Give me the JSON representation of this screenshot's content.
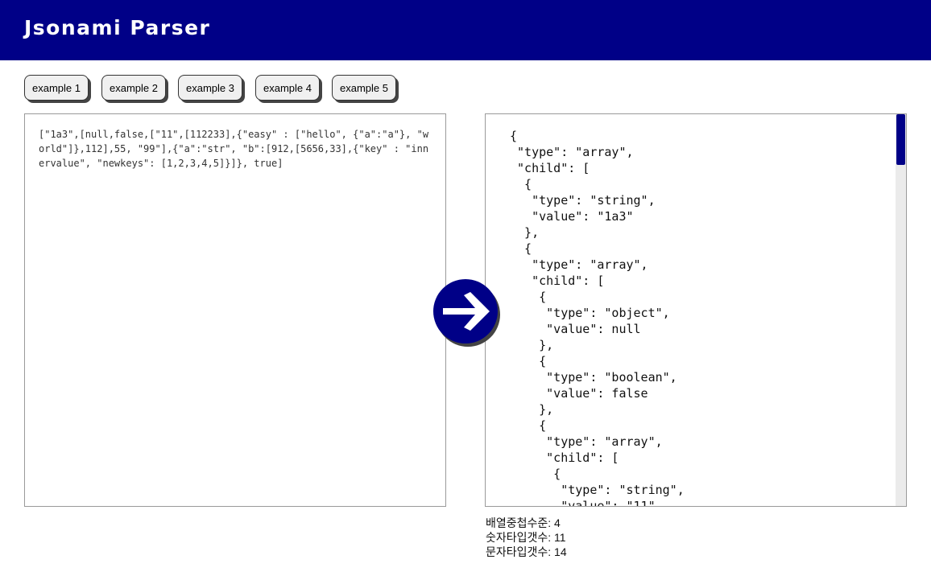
{
  "header": {
    "title": "Jsonami Parser"
  },
  "examples": [
    "example 1",
    "example 2",
    "example 3",
    "example 4",
    "example 5"
  ],
  "input": {
    "text": "[\"1a3\",[null,false,[\"11\",[112233],{\"easy\" : [\"hello\", {\"a\":\"a\"}, \"world\"]},112],55, \"99\"],{\"a\":\"str\", \"b\":[912,[5656,33],{\"key\" : \"innervalue\", \"newkeys\": [1,2,3,4,5]}]}, true]"
  },
  "output": {
    "text": "{\n \"type\": \"array\",\n \"child\": [\n  {\n   \"type\": \"string\",\n   \"value\": \"1a3\"\n  },\n  {\n   \"type\": \"array\",\n   \"child\": [\n    {\n     \"type\": \"object\",\n     \"value\": null\n    },\n    {\n     \"type\": \"boolean\",\n     \"value\": false\n    },\n    {\n     \"type\": \"array\",\n     \"child\": [\n      {\n       \"type\": \"string\",\n       \"value\": \"11\""
  },
  "arrow_icon": "arrow-right-icon",
  "colors": {
    "brand": "#000087",
    "button_bg": "#f0f0f0"
  },
  "stats": {
    "array_depth": "배열중첩수준: 4",
    "number_count": "숫자타입갯수: 11",
    "string_count": "문자타입갯수: 14"
  }
}
